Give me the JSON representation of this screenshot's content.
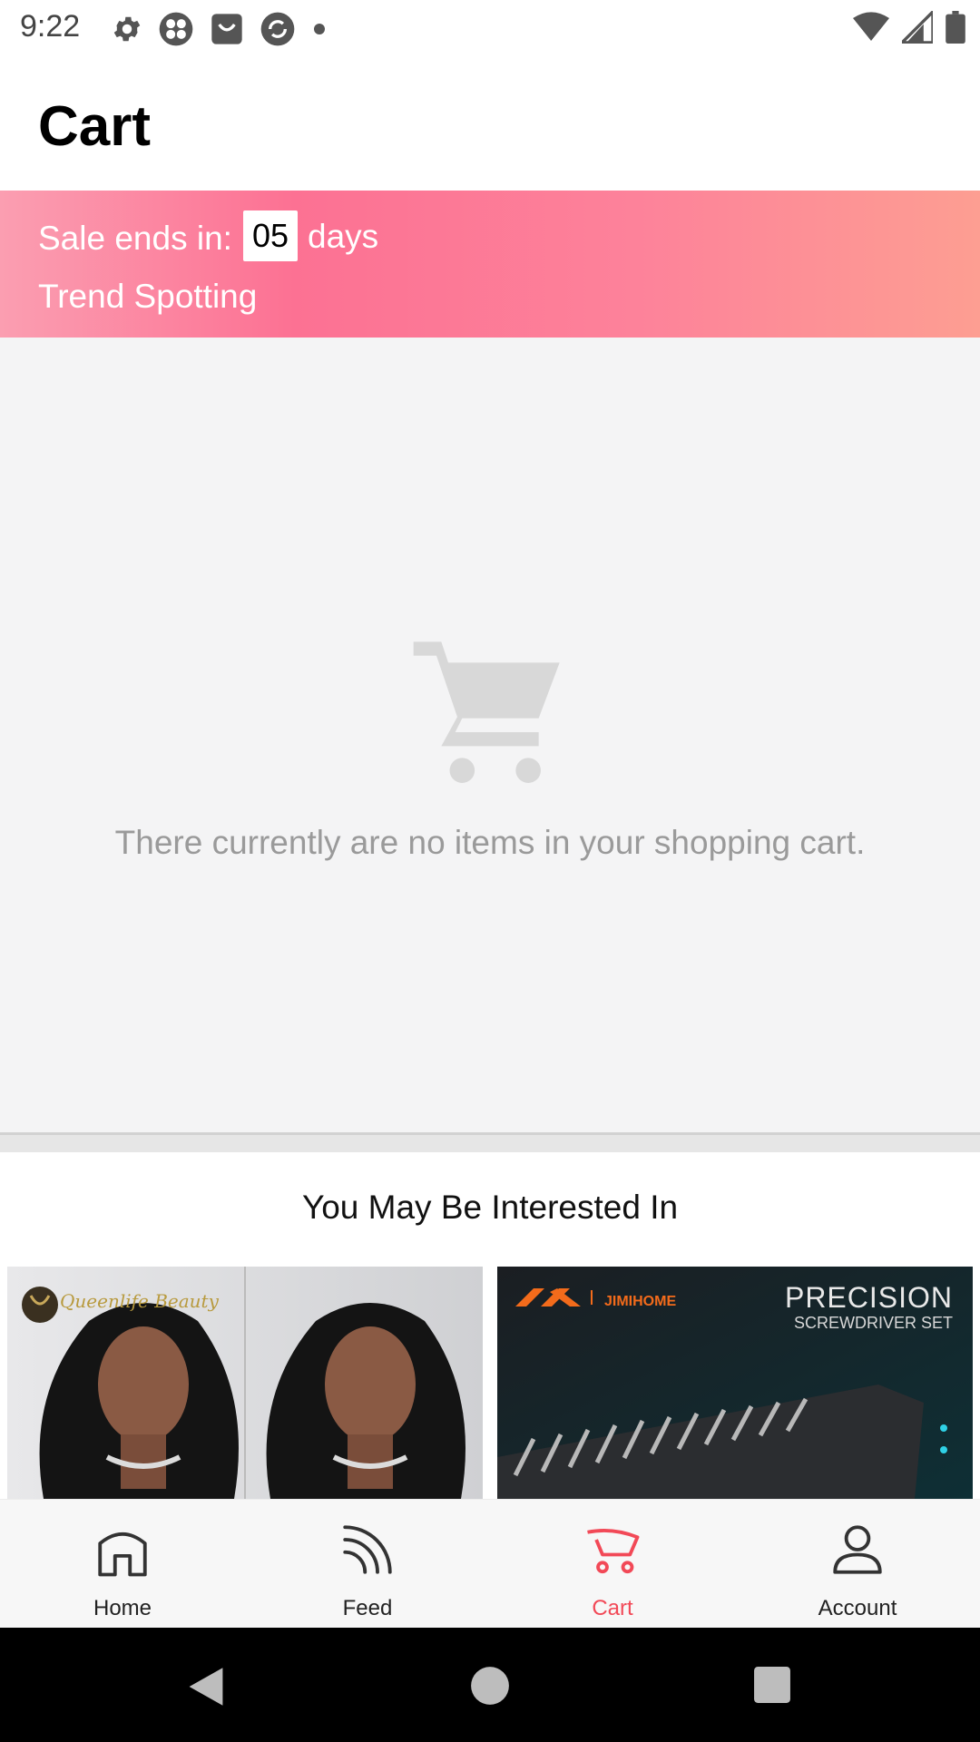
{
  "status_bar": {
    "time": "9:22",
    "left_icons": [
      "gear-icon",
      "pinwheel-icon",
      "store-bag-icon",
      "sync-icon",
      "dot-icon"
    ],
    "right_icons": [
      "wifi-icon",
      "signal-icon",
      "battery-icon"
    ]
  },
  "header": {
    "title": "Cart"
  },
  "sale_banner": {
    "label": "Sale ends in:",
    "days_value": "05",
    "days_label": "days",
    "subtitle": "Trend Spotting",
    "colors": [
      "#fc7193",
      "#fd9e92"
    ]
  },
  "empty_cart": {
    "icon": "shopping-cart-icon",
    "message": "There currently are no items in your shopping cart."
  },
  "recommendations": {
    "title": "You May Be Interested In",
    "products": [
      {
        "brand": "Queenlife Beauty",
        "image": "hair-wig-photo"
      },
      {
        "brand": "JIMIHOME",
        "headline": "PRECISION",
        "subheadline": "SCREWDRIVER SET",
        "image": "screwdriver-set-photo"
      }
    ]
  },
  "bottom_nav": {
    "active_color": "#f24957",
    "items": [
      {
        "label": "Home",
        "icon": "home-icon"
      },
      {
        "label": "Feed",
        "icon": "feed-icon"
      },
      {
        "label": "Cart",
        "icon": "cart-icon"
      },
      {
        "label": "Account",
        "icon": "account-icon"
      }
    ]
  },
  "system_nav": {
    "buttons": [
      "back-icon",
      "home-circle-icon",
      "recents-icon"
    ]
  }
}
